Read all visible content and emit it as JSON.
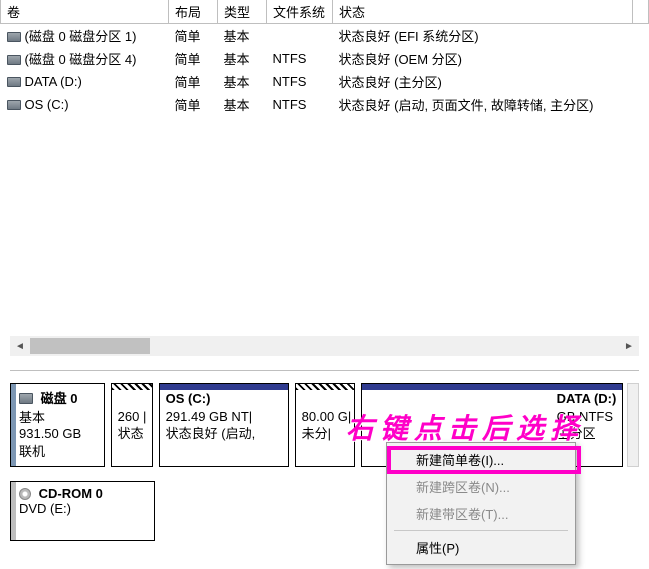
{
  "columns": {
    "volume": "卷",
    "layout": "布局",
    "type": "类型",
    "fs": "文件系统",
    "status": "状态"
  },
  "volumes": [
    {
      "name": "(磁盘 0 磁盘分区 1)",
      "layout": "简单",
      "type": "基本",
      "fs": "",
      "status": "状态良好 (EFI 系统分区)"
    },
    {
      "name": "(磁盘 0 磁盘分区 4)",
      "layout": "简单",
      "type": "基本",
      "fs": "NTFS",
      "status": "状态良好 (OEM 分区)"
    },
    {
      "name": "DATA (D:)",
      "layout": "简单",
      "type": "基本",
      "fs": "NTFS",
      "status": "状态良好 (主分区)"
    },
    {
      "name": "OS (C:)",
      "layout": "简单",
      "type": "基本",
      "fs": "NTFS",
      "status": "状态良好 (启动, 页面文件, 故障转储, 主分区)"
    }
  ],
  "disk0": {
    "title": "磁盘 0",
    "kind": "基本",
    "size": "931.50 GB",
    "state": "联机",
    "parts": {
      "p1": {
        "size_line": "260 |",
        "status_line": "状态"
      },
      "p2": {
        "name": "OS  (C:)",
        "size_line": "291.49 GB NT|",
        "status_line": "状态良好 (启动,"
      },
      "p3": {
        "size_line": "80.00 G|",
        "status_line": "未分|"
      },
      "p4": {
        "name": "DATA  (D:)",
        "size_line": "GB NTFS",
        "status_line": "主分区"
      }
    }
  },
  "cdrom": {
    "title": "CD-ROM 0",
    "line": "DVD (E:)"
  },
  "context_menu": {
    "new_simple": "新建简单卷(I)...",
    "new_spanned": "新建跨区卷(N)...",
    "new_striped": "新建带区卷(T)...",
    "properties": "属性(P)"
  },
  "annotation": "右键点击后选择"
}
